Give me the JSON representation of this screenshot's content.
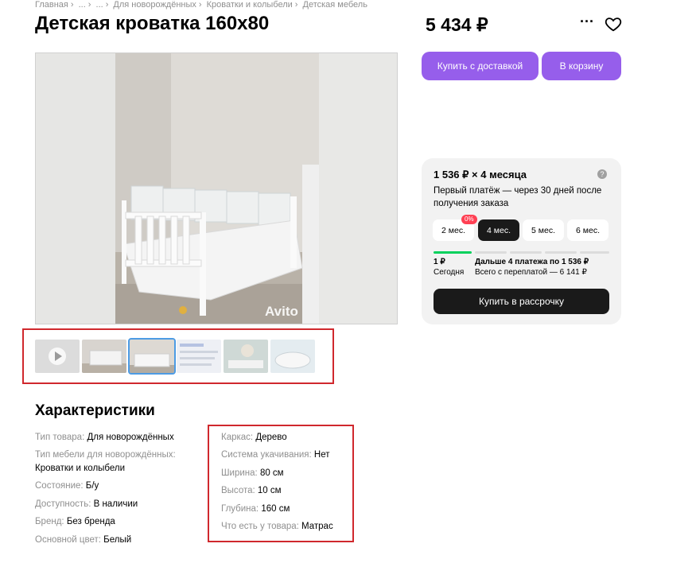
{
  "breadcrumb": [
    "Главная",
    "...",
    "...",
    "Для новорождённых",
    "Кроватки и колыбели",
    "Детская мебель"
  ],
  "title": "Детская кроватка 160x80",
  "price": "5 434 ₽",
  "actions": {
    "more": "···",
    "buy_delivery": "Купить с доставкой",
    "to_cart": "В корзину"
  },
  "photo": {
    "watermark": "Avito"
  },
  "installment": {
    "title": "1 536 ₽ × 4 месяца",
    "help": "?",
    "description": "Первый платёж — через 30 дней после получения заказа",
    "terms": [
      "2 мес.",
      "4 мес.",
      "5 мес.",
      "6 мес."
    ],
    "selected_term": "4 мес.",
    "badge": "0%",
    "today_amount": "1 ₽",
    "today_label": "Сегодня",
    "next_label": "Дальше 4 платежа по 1 536 ₽",
    "total_label": "Всего с переплатой — 6 141 ₽",
    "button": "Купить в рассрочку"
  },
  "characteristics": {
    "title": "Характеристики",
    "left": [
      {
        "key": "Тип товара:",
        "value": "Для новорождённых"
      },
      {
        "key": "Тип мебели для новорождённых:",
        "value": "Кроватки и колыбели"
      },
      {
        "key": "Состояние:",
        "value": "Б/у"
      },
      {
        "key": "Доступность:",
        "value": "В наличии"
      },
      {
        "key": "Бренд:",
        "value": "Без бренда"
      },
      {
        "key": "Основной цвет:",
        "value": "Белый"
      }
    ],
    "right": [
      {
        "key": "Каркас:",
        "value": "Дерево"
      },
      {
        "key": "Система укачивания:",
        "value": "Нет"
      },
      {
        "key": "Ширина:",
        "value": "80 см"
      },
      {
        "key": "Высота:",
        "value": "10 см"
      },
      {
        "key": "Глубина:",
        "value": "160 см"
      },
      {
        "key": "Что есть у товара:",
        "value": "Матрас"
      }
    ]
  },
  "colors": {
    "accent": "#965eeb",
    "highlight": "#d0282d",
    "success": "#02d15c",
    "badge": "#ff4053"
  }
}
